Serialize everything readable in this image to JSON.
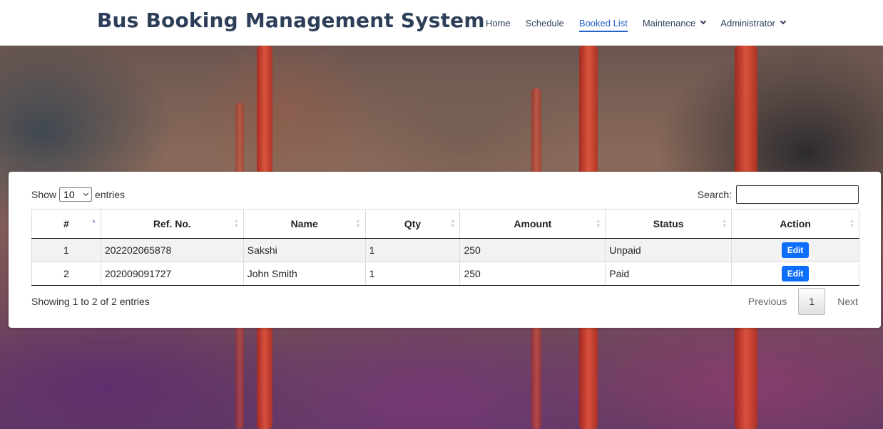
{
  "app": {
    "brand": "Bus Booking Management System"
  },
  "nav": {
    "items": [
      {
        "label": "Home",
        "active": false,
        "dropdown": false
      },
      {
        "label": "Schedule",
        "active": false,
        "dropdown": false
      },
      {
        "label": "Booked List",
        "active": true,
        "dropdown": false
      },
      {
        "label": "Maintenance",
        "active": false,
        "dropdown": true
      },
      {
        "label": "Administrator",
        "active": false,
        "dropdown": true
      }
    ]
  },
  "controls": {
    "show_label": "Show",
    "entries_value": "10",
    "entries_label": "entries",
    "search_label": "Search:",
    "search_value": ""
  },
  "table": {
    "columns": [
      "#",
      "Ref. No.",
      "Name",
      "Qty",
      "Amount",
      "Status",
      "Action"
    ],
    "sorted_column": "#",
    "sort_direction": "ascending",
    "rows": [
      {
        "num": "1",
        "ref": "202202065878",
        "name": "Sakshi",
        "qty": "1",
        "amount": "250",
        "status": "Unpaid",
        "action": "Edit"
      },
      {
        "num": "2",
        "ref": "202009091727",
        "name": "John Smith",
        "qty": "1",
        "amount": "250",
        "status": "Paid",
        "action": "Edit"
      }
    ]
  },
  "footer": {
    "info": "Showing 1 to 2 of 2 entries",
    "previous": "Previous",
    "current_page": "1",
    "next": "Next"
  },
  "colors": {
    "brand": "#2d3e58",
    "nav_active": "#2563c9",
    "edit_button": "#0d6efd"
  }
}
